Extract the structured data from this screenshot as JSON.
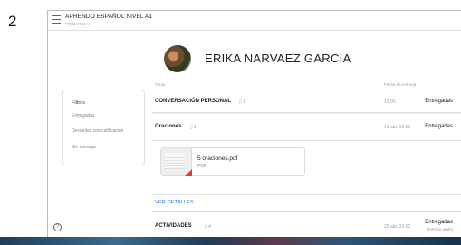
{
  "page_number": "2",
  "header": {
    "class_title": "APRENDO ESPAÑOL NIVEL A1",
    "class_subtitle": "PRIMARIO A"
  },
  "student": {
    "name": "ERIKA NARVAEZ GARCIA"
  },
  "columns": {
    "title": "Título",
    "due_date": "Fecha de entrega"
  },
  "filters": {
    "title": "Filtros",
    "items": [
      "Entregadas",
      "Devueltas con calificación",
      "Sin entregar"
    ]
  },
  "assignments": [
    {
      "title": "CONVERSACIÓN PERSONAL",
      "count": "1",
      "date": "13:00",
      "status": "Entregadas",
      "status_sub": ""
    },
    {
      "title": "Oraciones",
      "count": "1",
      "date": "13 abr. 10:00",
      "status": "Entregadas",
      "status_sub": ""
    },
    {
      "title": "ACTIVIDADES",
      "count": "4",
      "date": "23 abr. 10:00",
      "status": "Entregadas",
      "status_sub": "Entrega tardía"
    }
  ],
  "attachment": {
    "file_name": "5 oraciones.pdf",
    "file_type": "PDF"
  },
  "details_link": "VER DETALLES",
  "help_icon_label": "?",
  "icons": [
    "menu-icon",
    "people-icon",
    "help-icon",
    "pdf-icon"
  ],
  "colors": {
    "link": "#1a73e8",
    "pdf_red": "#e53935"
  }
}
